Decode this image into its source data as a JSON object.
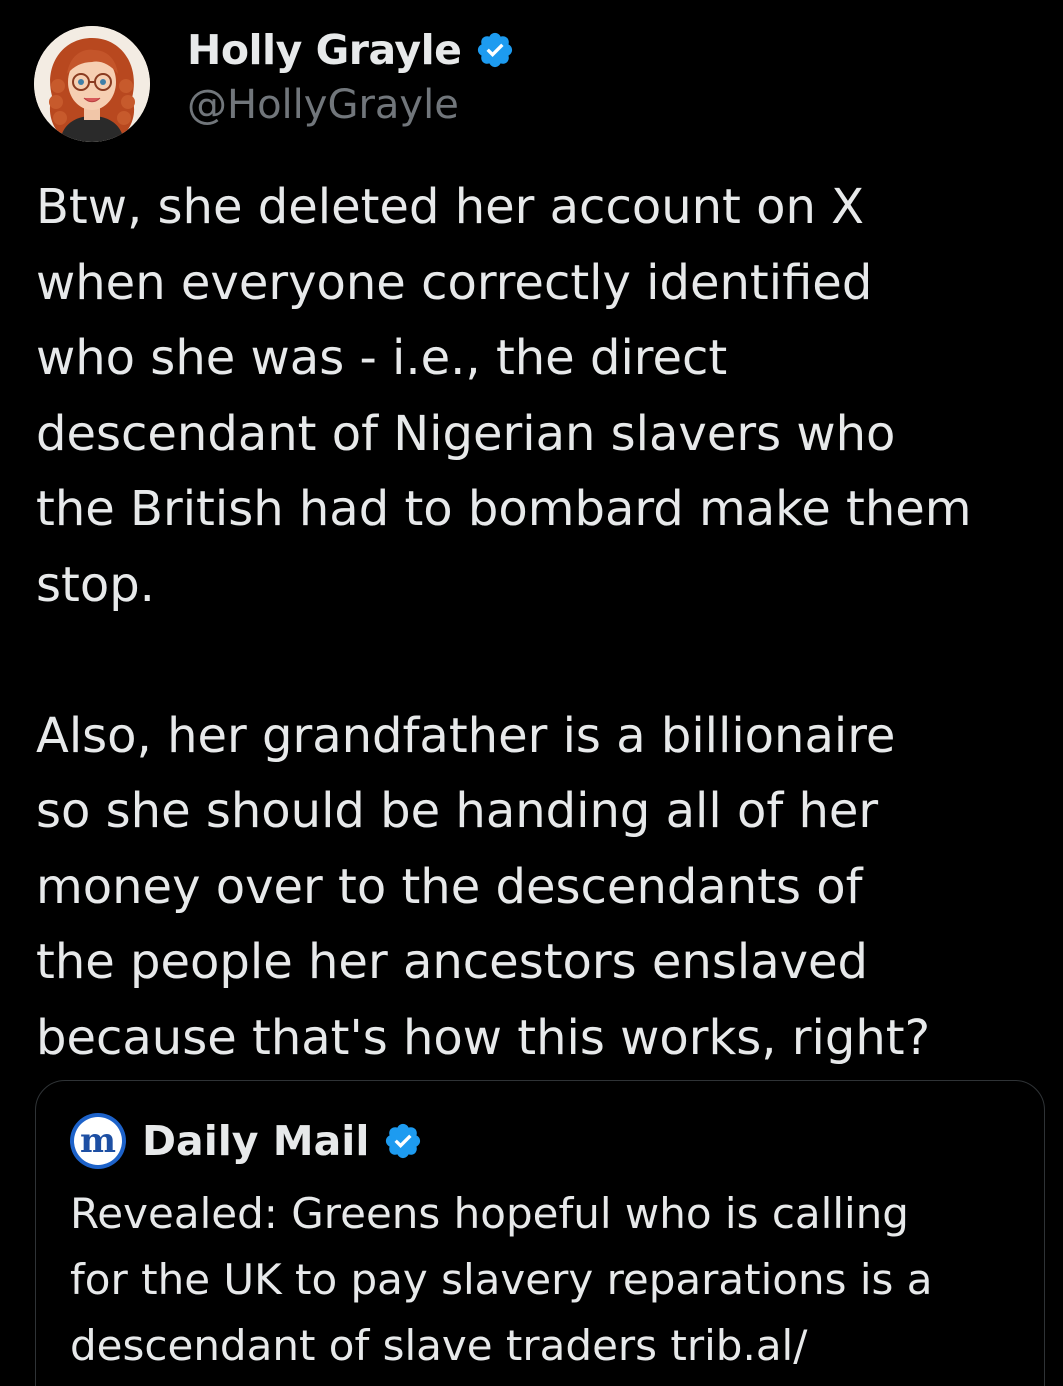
{
  "tweet": {
    "author_name": "Holly Grayle",
    "author_handle": "@HollyGrayle",
    "paragraphs": [
      "Btw, she deleted her account on X\nwhen everyone correctly identified\nwho she was - i.e., the direct\ndescendant of Nigerian slavers who\nthe British had to bombard make them\nstop.",
      "Also, her grandfather is a billionaire\nso she should be handing all of her\nmoney over to the descendants of\nthe people her ancestors enslaved\nbecause that's how this works, right?"
    ]
  },
  "quoted_tweet": {
    "author_name": "Daily Mail",
    "logo_letter": "m",
    "text": "Revealed: Greens hopeful who is calling\nfor the UK to pay slavery reparations is a\ndescendant of slave traders trib.al/"
  },
  "icons": {
    "author_avatar": "cartoon-avatar-red-curly-hair",
    "verified": "verified-badge-icon"
  },
  "colors": {
    "background": "#000000",
    "text_primary": "#e7e9ea",
    "text_secondary": "#71767b",
    "verified_blue": "#1d9bf0",
    "card_border": "#2f3336"
  }
}
